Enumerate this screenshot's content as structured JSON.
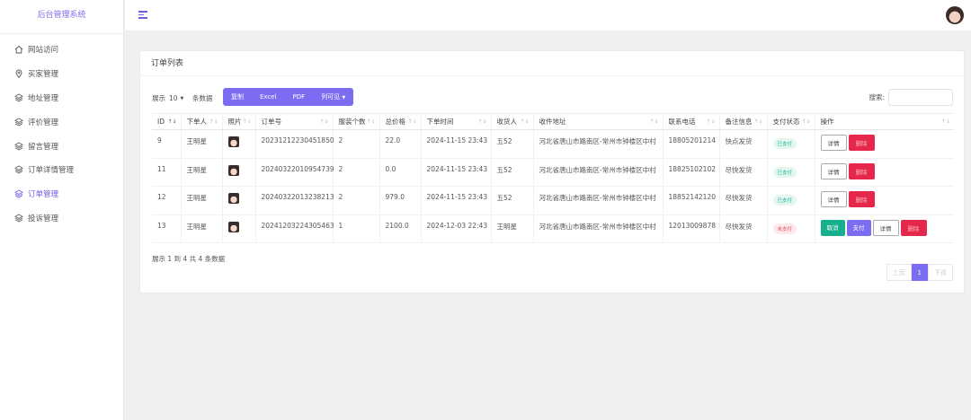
{
  "app": {
    "title": "后台管理系统"
  },
  "sidebar": {
    "items": [
      {
        "label": "网站访问",
        "icon": "home-icon"
      },
      {
        "label": "买家管理",
        "icon": "location-icon"
      },
      {
        "label": "地址管理",
        "icon": "layers-icon"
      },
      {
        "label": "评价管理",
        "icon": "layers-icon"
      },
      {
        "label": "留言管理",
        "icon": "layers-icon"
      },
      {
        "label": "订单详情管理",
        "icon": "layers-icon"
      },
      {
        "label": "订单管理",
        "icon": "layers-icon",
        "active": true
      },
      {
        "label": "投诉管理",
        "icon": "layers-icon"
      }
    ]
  },
  "card": {
    "title": "订单列表"
  },
  "controls": {
    "show_label": "展示",
    "page_length": "10",
    "entries_label": "条数据",
    "buttons": [
      "复制",
      "Excel",
      "PDF",
      "列可见"
    ],
    "search_label": "搜索:"
  },
  "table": {
    "headers": [
      "ID",
      "下单人",
      "照片",
      "订单号",
      "服装个数",
      "总价格",
      "下单时间",
      "收货人",
      "收件地址",
      "联系电话",
      "备注信息",
      "支付状态",
      "操作"
    ],
    "rows": [
      {
        "id": "9",
        "buyer": "王明星",
        "order_no": "20231212230451850",
        "qty": "2",
        "total": "22.0",
        "time": "2024-11-15 23:43",
        "receiver": "五52",
        "address": "河北省唐山市路南区-常州市钟楼区中村",
        "phone": "18805201214",
        "note": "快点发货",
        "status": "已支付"
      },
      {
        "id": "11",
        "buyer": "王明星",
        "order_no": "20240322010954739",
        "qty": "2",
        "total": "0.0",
        "time": "2024-11-15 23:43",
        "receiver": "五52",
        "address": "河北省唐山市路南区-常州市钟楼区中村",
        "phone": "18825102102",
        "note": "尽快发货",
        "status": "已支付"
      },
      {
        "id": "12",
        "buyer": "王明星",
        "order_no": "20240322013238213",
        "qty": "2",
        "total": "979.0",
        "time": "2024-11-15 23:43",
        "receiver": "五52",
        "address": "河北省唐山市路南区-常州市钟楼区中村",
        "phone": "18852142120",
        "note": "尽快发货",
        "status": "已支付"
      },
      {
        "id": "13",
        "buyer": "王明星",
        "order_no": "20241203224305463",
        "qty": "1",
        "total": "2100.0",
        "time": "2024-12-03 22:43",
        "receiver": "王明星",
        "address": "河北省唐山市路南区-常州市钟楼区中村",
        "phone": "12013009878",
        "note": "尽快发货",
        "status": "未支付"
      }
    ],
    "actions": {
      "detail": "详情",
      "delete": "删除",
      "cancel": "取消",
      "pay": "支付"
    }
  },
  "footer": {
    "info": "展示 1 到 4 共 4 条数据",
    "prev": "上页",
    "page": "1",
    "next": "下页"
  },
  "colors": {
    "accent": "#7c6cf2",
    "danger": "#e4274a",
    "success": "#16b08e"
  }
}
